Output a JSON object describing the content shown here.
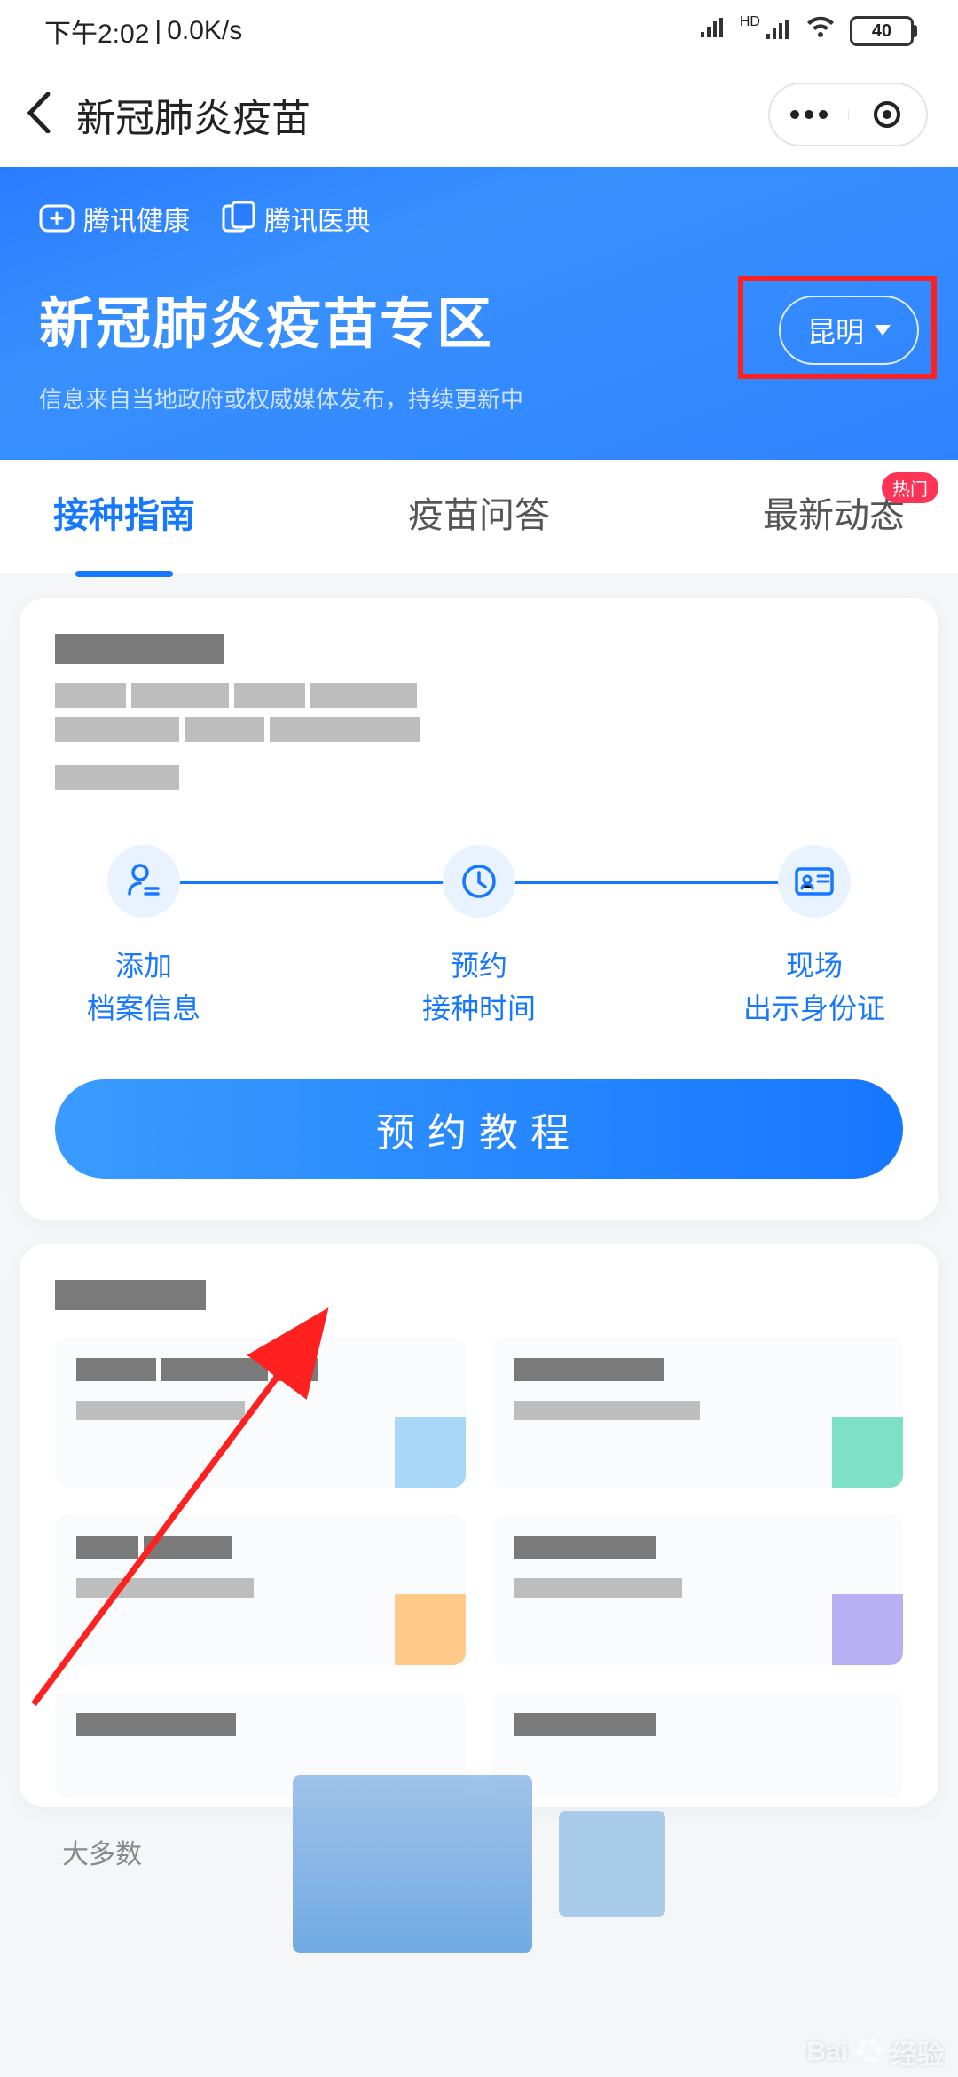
{
  "status": {
    "time": "下午2:02",
    "net": "0.0K/s",
    "battery": "40"
  },
  "nav": {
    "title": "新冠肺炎疫苗"
  },
  "hero": {
    "logo1": "腾讯健康",
    "logo2": "腾讯医典",
    "title": "新冠肺炎疫苗专区",
    "subtitle": "信息来自当地政府或权威媒体发布，持续更新中",
    "city": "昆明"
  },
  "tabs": [
    {
      "label": "接种指南",
      "active": true
    },
    {
      "label": "疫苗问答"
    },
    {
      "label": "最新动态",
      "badge": "热门"
    }
  ],
  "steps": [
    {
      "line1": "添加",
      "line2": "档案信息"
    },
    {
      "line1": "预约",
      "line2": "接种时间"
    },
    {
      "line1": "现场",
      "line2": "出示身份证"
    }
  ],
  "cta": "预约教程",
  "footer": "大多数",
  "watermark": "Baidu 经验"
}
